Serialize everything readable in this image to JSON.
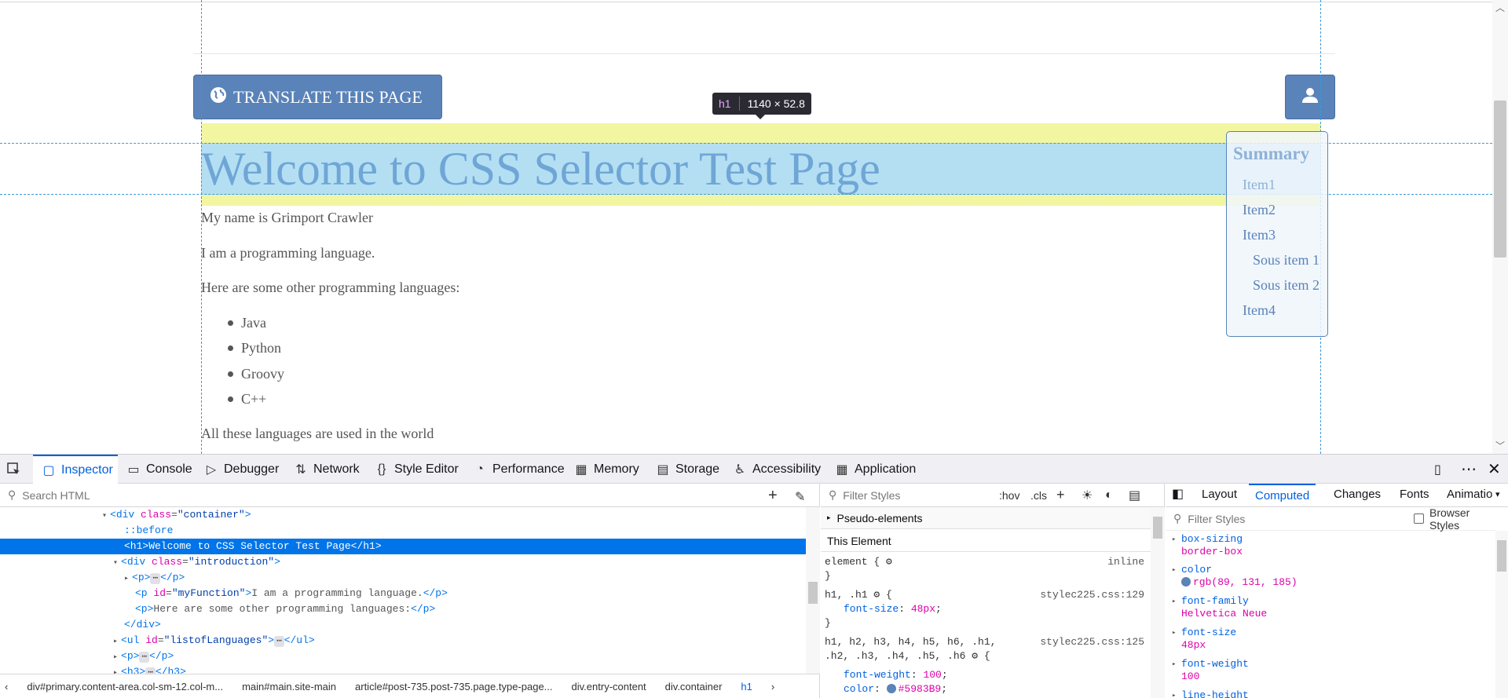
{
  "page": {
    "translate_label": "TRANSLATE THIS PAGE",
    "heading": "Welcome to CSS Selector Test Page",
    "tooltip_tag": "h1",
    "tooltip_size": "1140 × 52.8",
    "paragraphs": [
      "My name is Grimport Crawler",
      "I am a programming language.",
      "Here are some other programming languages:"
    ],
    "languages": [
      "Java",
      "Python",
      "Groovy",
      "C++"
    ],
    "footer_text": "All these languages are used in the world",
    "summary": {
      "title": "Summary",
      "items": [
        "Item1",
        "Item2",
        "Item3",
        "Sous item 1",
        "Sous item 2",
        "Item4"
      ]
    }
  },
  "devtools": {
    "tabs": [
      {
        "icon": "inspector-icon",
        "label": "Inspector"
      },
      {
        "icon": "console-icon",
        "label": "Console"
      },
      {
        "icon": "debugger-icon",
        "label": "Debugger"
      },
      {
        "icon": "network-icon",
        "label": "Network"
      },
      {
        "icon": "style-editor-icon",
        "label": "Style Editor"
      },
      {
        "icon": "performance-icon",
        "label": "Performance"
      },
      {
        "icon": "memory-icon",
        "label": "Memory"
      },
      {
        "icon": "storage-icon",
        "label": "Storage"
      },
      {
        "icon": "accessibility-icon",
        "label": "Accessibility"
      },
      {
        "icon": "application-icon",
        "label": "Application"
      }
    ],
    "search_placeholder": "Search HTML",
    "markup": {
      "l0_tag": "div",
      "l0_attr": "class",
      "l0_val": "\"container\"",
      "l1": "::before",
      "l2": "<h1>Welcome to CSS Selector Test Page</h1>",
      "l3_tag": "div",
      "l3_attr": "class",
      "l3_val": "\"introduction\"",
      "l4_tag": "p",
      "l5_attr": "id",
      "l5_val": "\"myFunction\"",
      "l5_text": "I am a programming language.",
      "l6_text": "Here are some other programming languages:",
      "l7": "</div>",
      "l8_attr": "id",
      "l8_val": "\"listofLanguages\"",
      "l9_tag": "p",
      "l10_tag": "h3"
    },
    "breadcrumbs": [
      "div#primary.content-area.col-sm-12.col-m...",
      "main#main.site-main",
      "article#post-735.post-735.page.type-page...",
      "div.entry-content",
      "div.container",
      "h1"
    ],
    "rules": {
      "filter_placeholder": "Filter Styles",
      "hov": ":hov",
      "cls": ".cls",
      "pseudo_elements": "Pseudo-elements",
      "this_element": "This Element",
      "element_selector": "element {",
      "element_src": "inline",
      "close_brace": "}",
      "rule1_selector": "h1, .h1",
      "rule1_src": "stylec225.css:129",
      "rule1_prop": "font-size",
      "rule1_val": "48px",
      "rule2_selector_a": "h1, h2, h3, h4, h5, h6, .h1,",
      "rule2_selector_b": ".h2, .h3, .h4, .h5, .h6",
      "rule2_src": "stylec225.css:125",
      "rule2_prop1": "font-weight",
      "rule2_val1": "100",
      "rule2_prop2": "color",
      "rule2_val2": "#5983B9"
    },
    "side_tabs": [
      "Layout",
      "Computed",
      "Changes",
      "Fonts",
      "Animatio"
    ],
    "computed": {
      "filter_placeholder": "Filter Styles",
      "browser_styles": "Browser Styles",
      "props": [
        {
          "name": "box-sizing",
          "value": "border-box"
        },
        {
          "name": "color",
          "value": "rgb(89, 131, 185)"
        },
        {
          "name": "font-family",
          "value": "Helvetica Neue"
        },
        {
          "name": "font-size",
          "value": "48px"
        },
        {
          "name": "font-weight",
          "value": "100"
        },
        {
          "name": "line-height",
          "value": ""
        }
      ]
    }
  },
  "colors": {
    "accent": "#5983b9",
    "devtools_blue": "#0060df",
    "selection": "#0074e8"
  }
}
